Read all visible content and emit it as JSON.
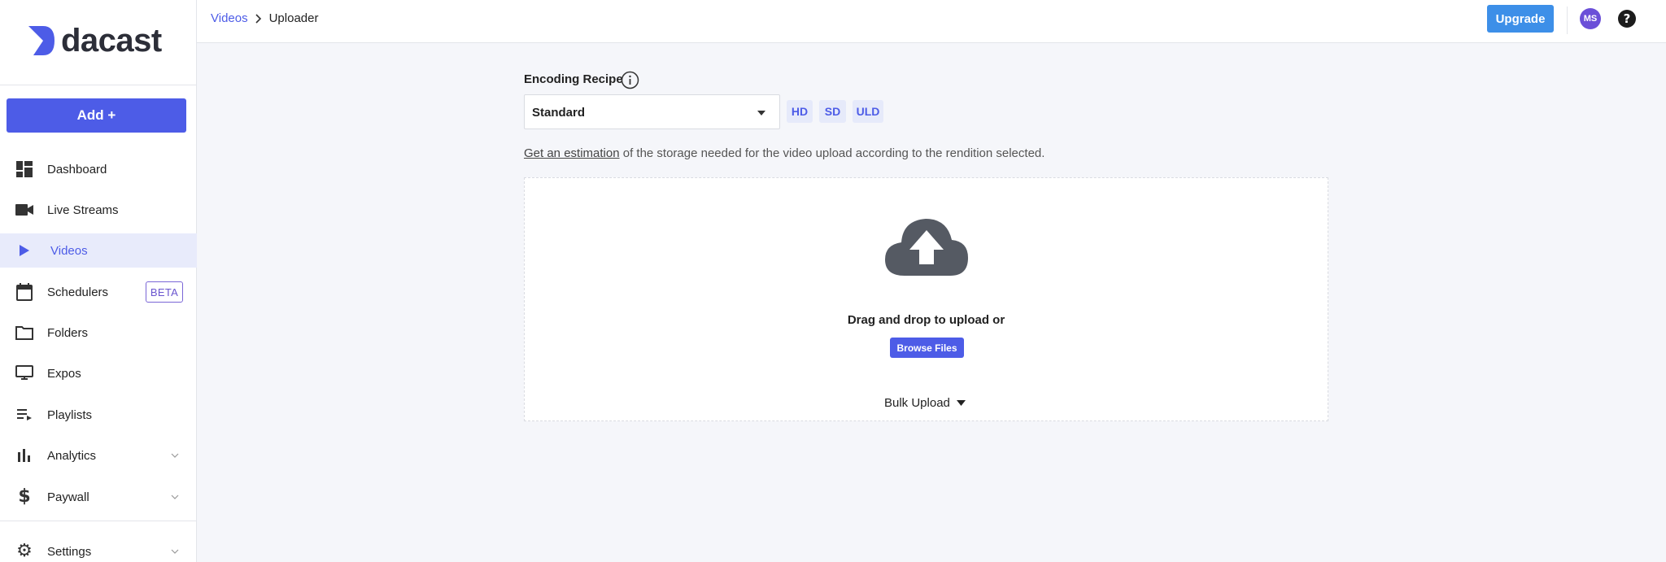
{
  "brand": {
    "name": "dacast",
    "accent": "#4d5ce7"
  },
  "sidebar": {
    "add_label": "Add +",
    "items": [
      {
        "label": "Dashboard",
        "icon": "dashboard-icon"
      },
      {
        "label": "Live Streams",
        "icon": "camera-icon"
      },
      {
        "label": "Videos",
        "icon": "play-icon",
        "active": true
      },
      {
        "label": "Schedulers",
        "icon": "calendar-icon",
        "badge": "BETA"
      },
      {
        "label": "Folders",
        "icon": "folder-icon"
      },
      {
        "label": "Expos",
        "icon": "monitor-icon"
      },
      {
        "label": "Playlists",
        "icon": "playlist-icon"
      },
      {
        "label": "Analytics",
        "icon": "bar-chart-icon",
        "expandable": true
      },
      {
        "label": "Paywall",
        "icon": "dollar-icon",
        "expandable": true
      },
      {
        "label": "Settings",
        "icon": "gear-icon",
        "expandable": true
      }
    ]
  },
  "header": {
    "breadcrumb": {
      "parent": "Videos",
      "current": "Uploader"
    },
    "upgrade_label": "Upgrade",
    "avatar_initials": "MS"
  },
  "main": {
    "encoding_label": "Encoding Recipe",
    "recipe_value": "Standard",
    "renditions": [
      "HD",
      "SD",
      "ULD"
    ],
    "estimate_link": "Get an estimation",
    "estimate_text": " of the storage needed for the video upload according to the rendition selected.",
    "drag_text": "Drag and drop to upload or",
    "browse_label": "Browse Files",
    "bulk_label": "Bulk Upload"
  }
}
